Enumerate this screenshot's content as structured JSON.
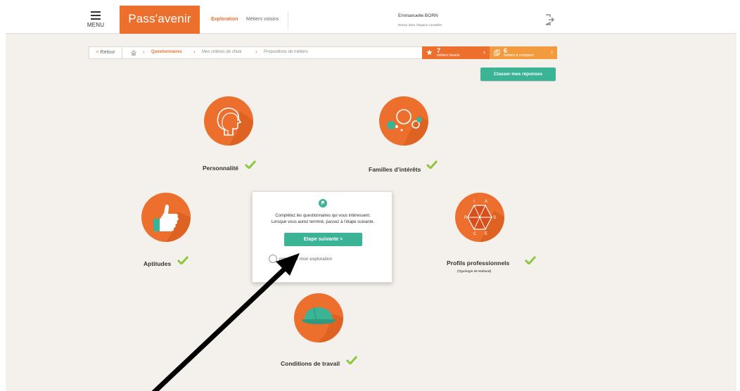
{
  "header": {
    "menu_label": "MENU",
    "brand": "Pass'avenir",
    "nav_exploration": "Exploration",
    "nav_metiers_voisins": "Métiers voisins",
    "user_name": "Emmanuelle BORN",
    "user_sub": "Retour dans l'espace conseiller",
    "menu_icon": "hamburger-icon",
    "logout_icon": "logout-icon"
  },
  "breadcrumb": {
    "back_label": "Retour",
    "home_icon": "home-icon",
    "items": [
      {
        "label": "Questionnaires",
        "active": true
      },
      {
        "label": "Mes critères de choix",
        "active": false
      },
      {
        "label": "Propositions de métiers",
        "active": false
      }
    ],
    "favorites": {
      "count": "7",
      "label": "métiers favoris",
      "icon": "star-icon"
    },
    "compare": {
      "count": "6",
      "label": "métiers à comparer",
      "icon": "compare-icon"
    }
  },
  "rank_button": "Classer mes réponses",
  "questionnaires": [
    {
      "key": "personnalite",
      "label": "Personnalité",
      "icon": "head-profile-icon",
      "done": true
    },
    {
      "key": "familles",
      "label": "Familles d'intérêts",
      "icon": "interest-bubbles-icon",
      "done": true
    },
    {
      "key": "aptitudes",
      "label": "Aptitudes",
      "icon": "thumbs-up-icon",
      "done": true
    },
    {
      "key": "profils",
      "label": "Profils professionnels",
      "sub": "(Typologie de Holland)",
      "icon": "holland-hexagon-icon",
      "done": true,
      "riasec": [
        "R",
        "I",
        "A",
        "S",
        "E",
        "C"
      ]
    },
    {
      "key": "conditions",
      "label": "Conditions de travail",
      "icon": "hard-hat-icon",
      "done": true
    }
  ],
  "modal": {
    "flag_icon": "flag-icon",
    "text_line1": "Complétez les questionnaires qui vous intéressent.",
    "text_line2": "Lorsque vous aurez terminé, passez à l'étape suivante.",
    "next_button": "Etape suivante >",
    "option_label": "mmencer mon exploration"
  },
  "annotation": {
    "icon": "black-arrow-icon"
  },
  "colors": {
    "brand_orange": "#ec6f2d",
    "compare_orange": "#f19a3e",
    "teal": "#3bb395",
    "check_green": "#8dc63f",
    "background": "#f4f1ec"
  }
}
